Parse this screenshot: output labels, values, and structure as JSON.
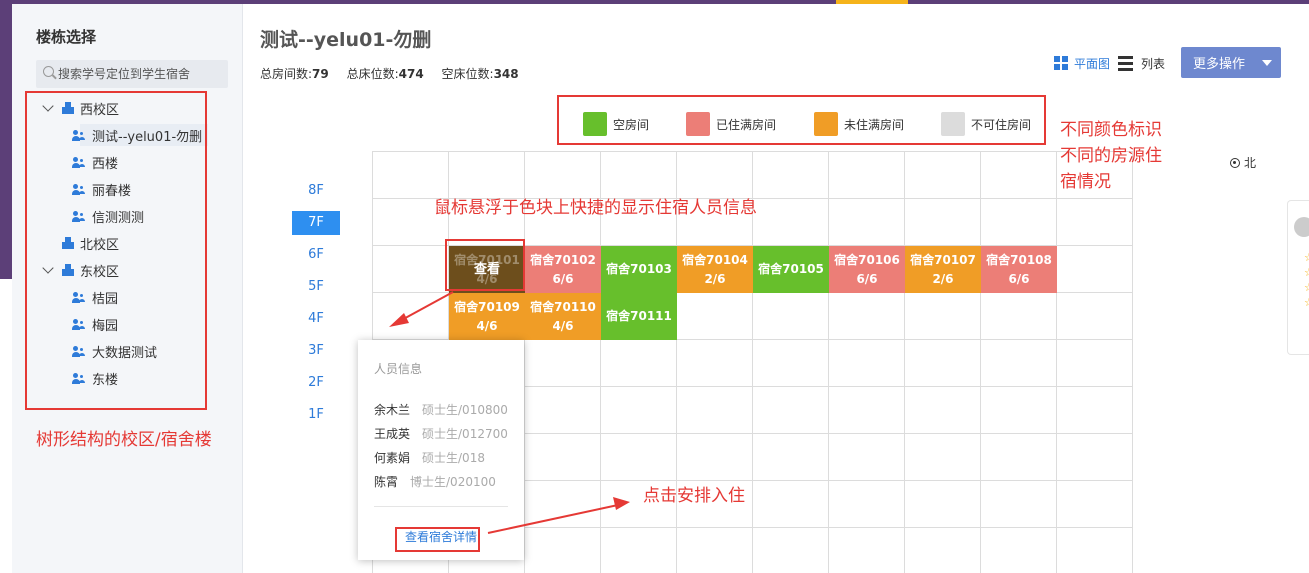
{
  "sidebar": {
    "title": "楼栋选择",
    "search_placeholder": "搜索学号定位到学生宿舍",
    "tree": [
      {
        "label": "西校区",
        "type": "campus",
        "expanded": true
      },
      {
        "label": "测试--yelu01-勿删",
        "type": "building",
        "selected": true
      },
      {
        "label": "西楼",
        "type": "building"
      },
      {
        "label": "丽春楼",
        "type": "building"
      },
      {
        "label": "信测测测",
        "type": "building"
      },
      {
        "label": "北校区",
        "type": "campus",
        "expanded": false
      },
      {
        "label": "东校区",
        "type": "campus",
        "expanded": true
      },
      {
        "label": "桔园",
        "type": "building"
      },
      {
        "label": "梅园",
        "type": "building"
      },
      {
        "label": "大数据测试",
        "type": "building"
      },
      {
        "label": "东楼",
        "type": "building"
      }
    ]
  },
  "main": {
    "title": "测试--yelu01-勿删",
    "stats": {
      "total_rooms_label": "总房间数:",
      "total_rooms": "79",
      "total_beds_label": "总床位数:",
      "total_beds": "474",
      "empty_beds_label": "空床位数:",
      "empty_beds": "348"
    },
    "view": {
      "grid_label": "平面图",
      "list_label": "列表",
      "active": "grid"
    },
    "more_button": "更多操作",
    "legend": [
      {
        "label": "空房间",
        "color": "#67bf2c"
      },
      {
        "label": "已住满房间",
        "color": "#ec7e77"
      },
      {
        "label": "未住满房间",
        "color": "#f09d26"
      },
      {
        "label": "不可住房间",
        "color": "#dcdcdc"
      }
    ],
    "compass": "北",
    "floors": [
      "8F",
      "7F",
      "6F",
      "5F",
      "4F",
      "3F",
      "2F",
      "1F"
    ],
    "active_floor": "7F",
    "rooms_row1": [
      {
        "name": "宿舍70101",
        "occ": "4/6",
        "status": "hovered",
        "overlay": "查看"
      },
      {
        "name": "宿舍70102",
        "occ": "6/6",
        "status": "full"
      },
      {
        "name": "宿舍70103",
        "occ": "",
        "status": "empty"
      },
      {
        "name": "宿舍70104",
        "occ": "2/6",
        "status": "partial"
      },
      {
        "name": "宿舍70105",
        "occ": "",
        "status": "empty"
      },
      {
        "name": "宿舍70106",
        "occ": "6/6",
        "status": "full"
      },
      {
        "name": "宿舍70107",
        "occ": "2/6",
        "status": "partial"
      },
      {
        "name": "宿舍70108",
        "occ": "6/6",
        "status": "full"
      }
    ],
    "rooms_row2": [
      {
        "name": "宿舍70109",
        "occ": "4/6",
        "status": "partial"
      },
      {
        "name": "宿舍70110",
        "occ": "4/6",
        "status": "partial"
      },
      {
        "name": "宿舍70111",
        "occ": "",
        "status": "empty"
      }
    ]
  },
  "popup": {
    "title": "人员信息",
    "people": [
      {
        "name": "余木兰",
        "info": "硕士生/010800"
      },
      {
        "name": "王成英",
        "info": "硕士生/012700"
      },
      {
        "name": "何素娟",
        "info": "硕士生/018"
      },
      {
        "name": "陈霄",
        "info": "博士生/020100"
      }
    ],
    "link": "查看宿舍详情"
  },
  "annotations": {
    "tree_note": "树形结构的校区/宿舍楼",
    "hover_note": "鼠标悬浮于色块上快捷的显示住宿人员信息",
    "color_note_1": "不同颜色标识",
    "color_note_2": "不同的房源住",
    "color_note_3": "宿情况",
    "click_note": "点击安排入住"
  }
}
